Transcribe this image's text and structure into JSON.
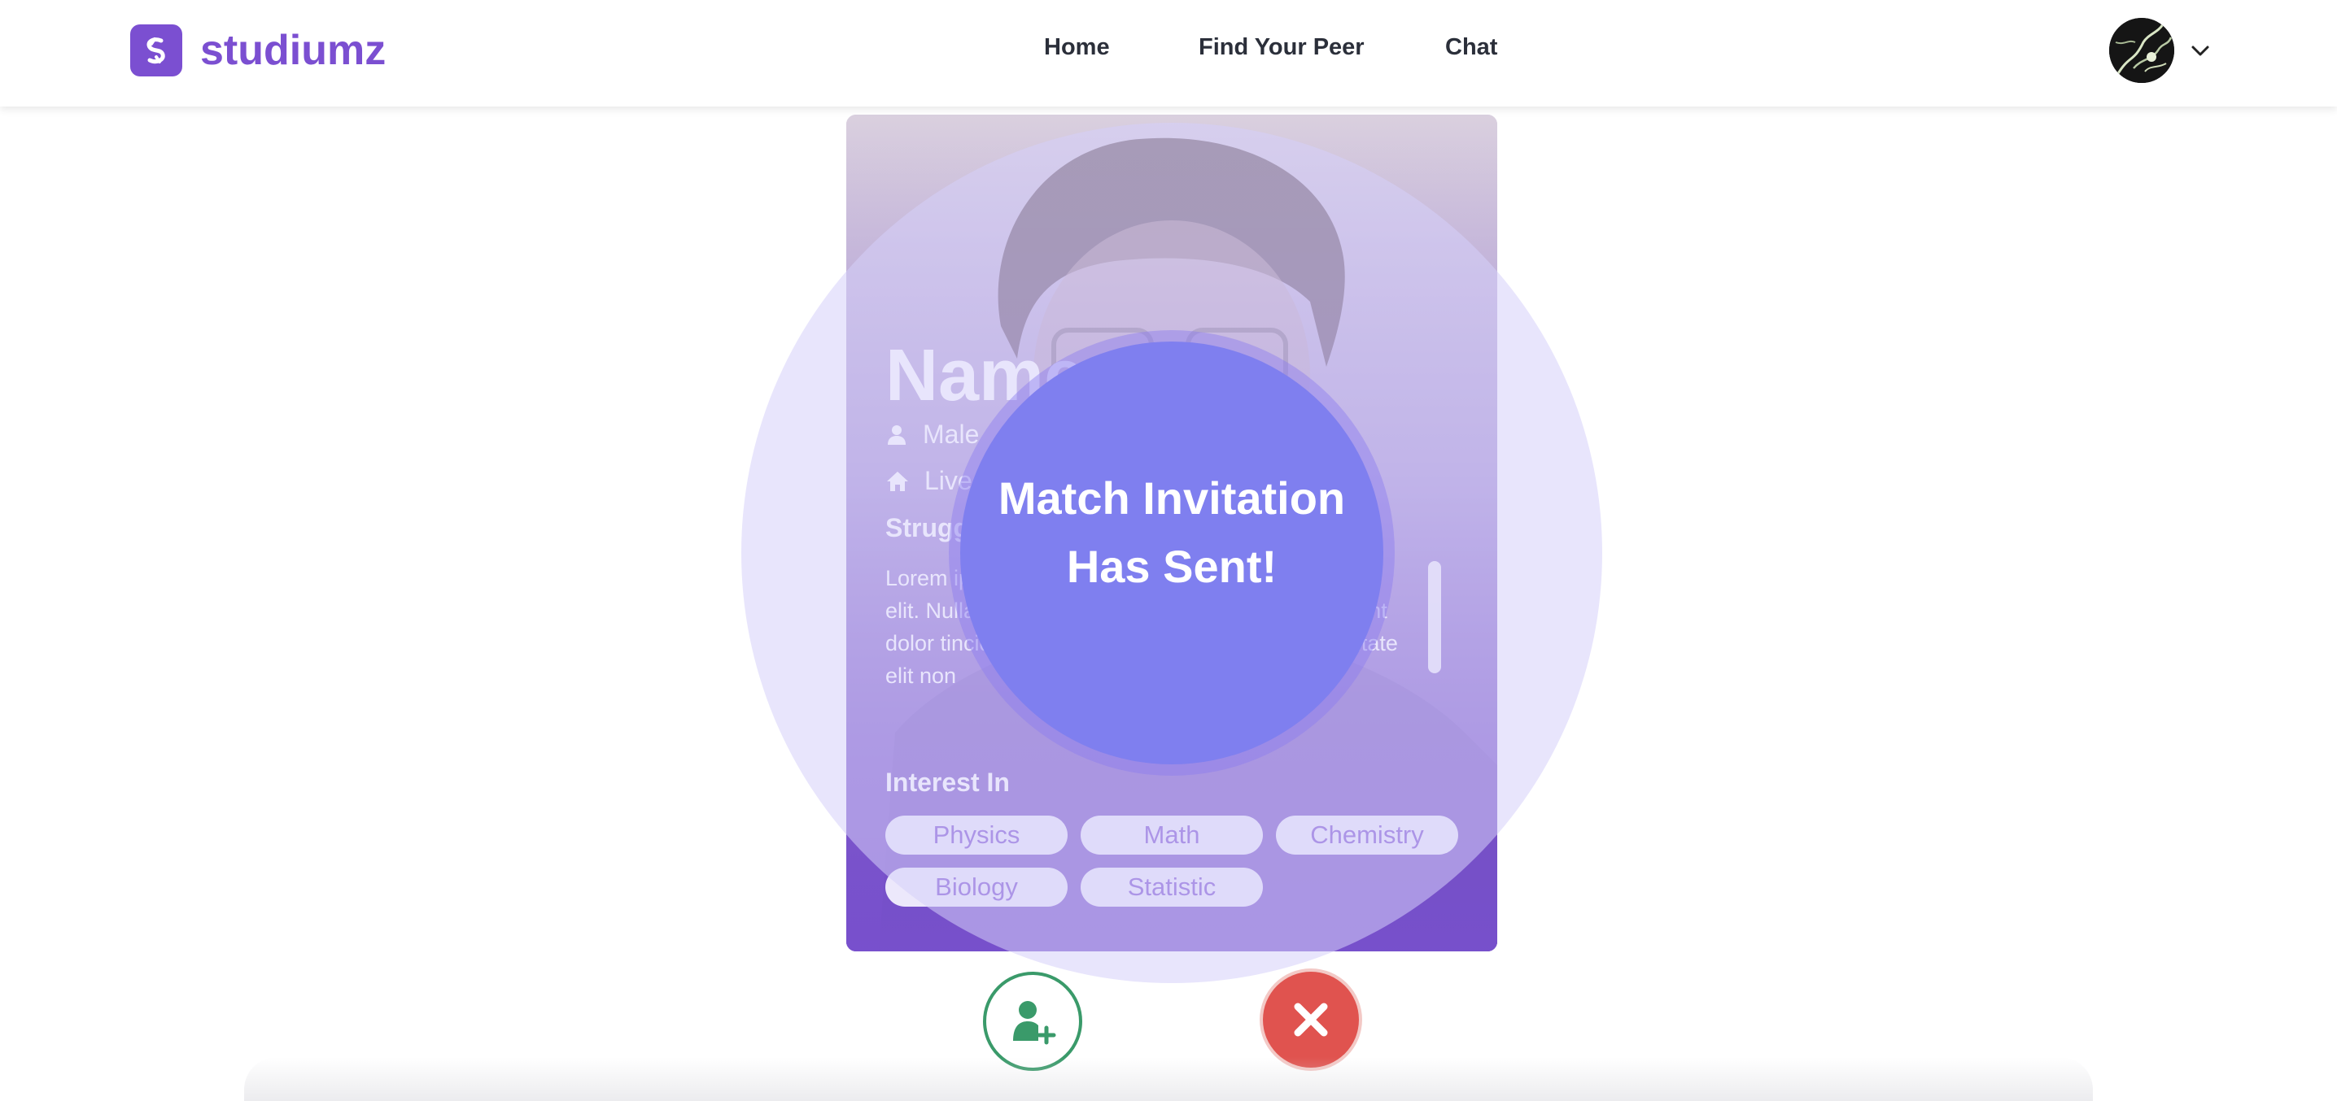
{
  "brand": {
    "name": "studiumz",
    "accent": "#7b4fd1"
  },
  "nav": {
    "items": [
      {
        "label": "Home"
      },
      {
        "label": "Find Your Peer"
      },
      {
        "label": "Chat"
      }
    ]
  },
  "profile": {
    "name": "Name",
    "gender": "Male",
    "location": "Live",
    "struggle_title": "Strugg",
    "bio": "Lorem ipsum dolor sit amet, consectetur adipiscing elit. Nullam ullamcorper tincidunt diam non tincidunt dolor tincidunt dolor, efficitur pulvinar. Nulla vulputate elit non",
    "interest_title": "Interest In",
    "interests": [
      "Physics",
      "Math",
      "Chemistry",
      "Biology",
      "Statistic"
    ]
  },
  "match": {
    "line1": "Match Invitation",
    "line2": "Has Sent!"
  },
  "actions": {
    "accept_icon": "user-plus-icon",
    "reject_icon": "close-icon",
    "accept_color": "#3a9a6a",
    "reject_color": "#e0534f"
  }
}
